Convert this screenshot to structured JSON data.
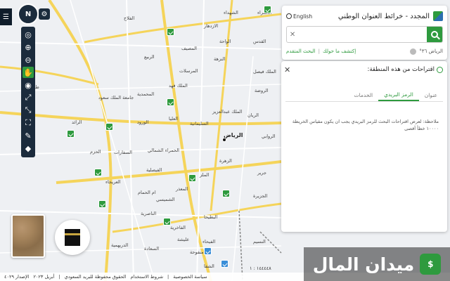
{
  "app": {
    "title": "المجدد - خرائط العنوان الوطني",
    "language_button": "English"
  },
  "search": {
    "placeholder": "",
    "location": "الرياض ٣٦°",
    "link_nearby": "إكتشف ما حولك",
    "link_advanced": "البحث المتقدم"
  },
  "suggestions": {
    "title": "اقتراحات من هذه المنطقة:",
    "tabs": [
      "عنوان",
      "الرمز البريدي",
      "الخدمات"
    ],
    "active_tab": 1,
    "note": "ملاحظة: لعرض اقتراحات البحث للرمز البريدي يجب ان يكون مقياس الخريطة ١٠٠٠٠ خطأ أقصى"
  },
  "map": {
    "labels": [
      "الشهداء",
      "الحمراء",
      "الازدهار",
      "القدس",
      "الواحة",
      "الملك فيصل",
      "الفلاح",
      "المرسلات",
      "النزهة",
      "الربيع",
      "المصيف",
      "المحمدية",
      "الملك فهد",
      "جامعة الملك سعود",
      "الرائد",
      "الملك عبدالعزيز",
      "الروضة",
      "الروابي",
      "السليمانية",
      "العليا",
      "الورود",
      "الريان",
      "الرياض",
      "الزهرة",
      "السفارات",
      "الحزم",
      "الفاخرية",
      "الملز",
      "جرير",
      "الشميسي",
      "الفيصلية",
      "العريجاء",
      "الناصرية",
      "البطيحا",
      "الفيحاء",
      "الحمراء الشمالي",
      "ام الحمام",
      "المعذر",
      "عليشة",
      "الجزيرة",
      "النسيم",
      "السعادة",
      "منفوحة",
      "الدريهمية",
      "الشفا",
      "طويق"
    ],
    "city_label": "الرياض"
  },
  "footer": {
    "items": [
      "سياسة الخصوصية",
      "شروط الاستخدام",
      "الحقوق محفوظة للبريد السعودي",
      "أبريل ٢٠٢٣",
      "الإصدار ٤٠٢٩"
    ],
    "scale": "١٤٤٤٤٨ : ١"
  },
  "watermark": {
    "text": "ميدان المال"
  },
  "toolbar": {
    "compass_label": "N"
  }
}
